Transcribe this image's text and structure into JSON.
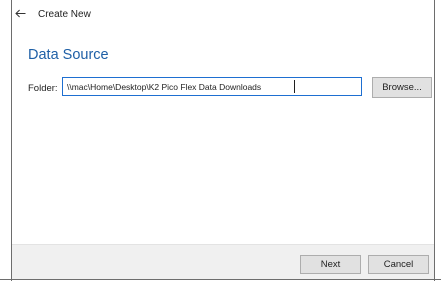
{
  "dialog": {
    "title": "Create New",
    "back_icon": "arrow-left-icon"
  },
  "main": {
    "heading": "Data Source",
    "folder_label": "Folder:",
    "folder_value": "\\\\mac\\Home\\Desktop\\K2 Pico Flex Data Downloads",
    "browse_label": "Browse..."
  },
  "footer": {
    "next_label": "Next",
    "cancel_label": "Cancel"
  },
  "colors": {
    "heading": "#1e5fa6",
    "input_focus_border": "#1e6fd1",
    "footer_bg": "#f0f0f0",
    "button_bg": "#e1e1e1"
  }
}
